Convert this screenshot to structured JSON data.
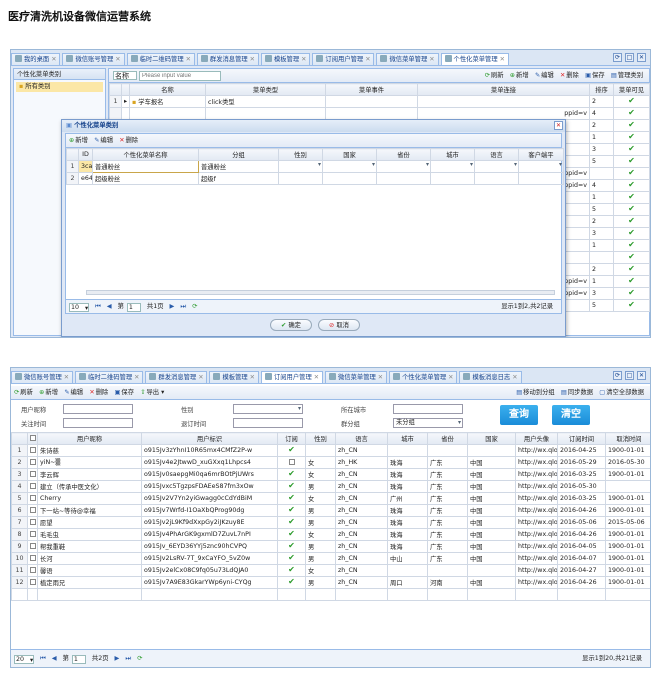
{
  "page_title": "医疗清洗机设备微信运营系统",
  "top": {
    "tabs": [
      "我的桌面",
      "微信账号管理",
      "临时二维码管理",
      "群发消息管理",
      "模板管理",
      "订阅用户管理",
      "微信菜单管理",
      "个性化菜单管理"
    ],
    "left_panel_title": "个性化菜单类别",
    "left_panel_item": "所有类别",
    "search_select": "名称",
    "search_placeholder": "Please input value",
    "toolbar": {
      "refresh": "刷新",
      "add": "新增",
      "edit": "编辑",
      "delete": "删除",
      "save": "保存",
      "manage": "管理类别"
    },
    "grid_headers": [
      "名称",
      "菜单类型",
      "菜单事件",
      "菜单连接",
      "排序",
      "菜单可见"
    ],
    "first_row": {
      "num": "1",
      "name": "学车报名",
      "type": "click类型"
    },
    "side_sort": [
      "2",
      "4",
      "2",
      "1",
      "3",
      "5",
      "",
      "4",
      "1",
      "5",
      "2",
      "3",
      "1",
      "",
      "2",
      "1",
      "3",
      "5"
    ],
    "ppid_label": "ppid=v",
    "dialog": {
      "title": "个性化菜单类别",
      "toolbar": {
        "add": "新增",
        "edit": "编辑",
        "delete": "删除"
      },
      "headers": [
        "ID",
        "个性化菜单名称",
        "分组",
        "性别",
        "国家",
        "省份",
        "城市",
        "语言",
        "客户端平"
      ],
      "rows": [
        {
          "num": "1",
          "id": "3ca",
          "name": "普通粉丝",
          "group": "普通粉丝"
        },
        {
          "num": "2",
          "id": "e64",
          "name": "超级粉丝",
          "group": "超级f"
        }
      ],
      "pager": {
        "size": "10",
        "page_label": "第",
        "page": "1",
        "total": "共1页",
        "info": "显示1到2,共2记录"
      },
      "ok": "确定",
      "cancel": "取消"
    }
  },
  "bottom": {
    "tabs": [
      "微信账号管理",
      "临时二维码管理",
      "群发消息管理",
      "模板管理",
      "订阅用户管理",
      "微信菜单管理",
      "个性化菜单管理",
      "模板消息日志"
    ],
    "toolbar": {
      "refresh": "刷新",
      "add": "新增",
      "edit": "编辑",
      "delete": "删除",
      "save": "保存",
      "export": "导出",
      "move_group": "移动到分组",
      "sync": "同步数据",
      "clear_all": "清空全部数据"
    },
    "filters": {
      "nickname": "用户昵称",
      "sex": "性别",
      "city": "所在城市",
      "follow_time": "关注时间",
      "unfollow_time": "退订时间",
      "group": "群分组",
      "group_value": "未分组",
      "query": "查询",
      "clear": "清空"
    },
    "headers": [
      "用户昵称",
      "用户标识",
      "订阅",
      "性别",
      "语言",
      "城市",
      "省份",
      "国家",
      "用户头像",
      "订阅时间",
      "取消时间"
    ],
    "rows": [
      {
        "n": "1",
        "nick": "朱诗慈",
        "openid": "o915Jv3zYhnI10R65mx4CMfZ2P-w",
        "sub": true,
        "sex": "",
        "lang": "zh_CN",
        "city": "",
        "prov": "",
        "country": "",
        "avatar": "http://wx.qlogo",
        "time": "2016-04-25",
        "cancel": "1900-01-01"
      },
      {
        "n": "2",
        "nick": "yiN~▒",
        "openid": "o915Jv4e2JtwwD_xuGXxq1Lhpcs4",
        "sub": false,
        "sex": "女",
        "lang": "zh_HK",
        "city": "珠海",
        "prov": "广东",
        "country": "中国",
        "avatar": "http://wx.qlogo",
        "time": "2016-05-29",
        "cancel": "2016-05-30"
      },
      {
        "n": "3",
        "nick": "李云辉",
        "openid": "o915Jv0saepgMi0qa6mrBOtPjUWrs",
        "sub": true,
        "sex": "女",
        "lang": "zh_CN",
        "city": "珠海",
        "prov": "广东",
        "country": "中国",
        "avatar": "http://wx.qlogo",
        "time": "2016-03-25",
        "cancel": "1900-01-01"
      },
      {
        "n": "4",
        "nick": "建立（传承中医文化）",
        "openid": "o915Jvxc5TgzpsFDAEeS87fm3xOw",
        "sub": true,
        "sex": "男",
        "lang": "zh_CN",
        "city": "珠海",
        "prov": "广东",
        "country": "中国",
        "avatar": "http://wx.qlogo",
        "time": "2016-05-30",
        "cancel": ""
      },
      {
        "n": "5",
        "nick": "Cherry",
        "openid": "o915Jv2V7Yn2yiGwagg0cCdYdBiM",
        "sub": true,
        "sex": "女",
        "lang": "zh_CN",
        "city": "广州",
        "prov": "广东",
        "country": "中国",
        "avatar": "http://wx.qlogo",
        "time": "2016-03-25",
        "cancel": "1900-01-01"
      },
      {
        "n": "6",
        "nick": "下一站~等待@幸福",
        "openid": "o915Jv7Wrfd-I1OaXbQProg90dg",
        "sub": true,
        "sex": "男",
        "lang": "zh_CN",
        "city": "珠海",
        "prov": "广东",
        "country": "中国",
        "avatar": "http://wx.qlogo",
        "time": "2016-04-26",
        "cancel": "1900-01-01"
      },
      {
        "n": "7",
        "nick": "愿望",
        "openid": "o915Jv2jL9Kf9dXxpGy2iJKzuy8E",
        "sub": true,
        "sex": "男",
        "lang": "zh_CN",
        "city": "珠海",
        "prov": "广东",
        "country": "中国",
        "avatar": "http://wx.qlogo",
        "time": "2016-05-06",
        "cancel": "2015-05-06"
      },
      {
        "n": "8",
        "nick": "毛毛虫",
        "openid": "o915Jv4PhArGK9gxmlD7ZuvL7nPI",
        "sub": true,
        "sex": "女",
        "lang": "zh_CN",
        "city": "珠海",
        "prov": "广东",
        "country": "中国",
        "avatar": "http://wx.qlogo",
        "time": "2016-04-26",
        "cancel": "1900-01-01"
      },
      {
        "n": "9",
        "nick": "帮我重鞋",
        "openid": "o915Jv_6EYD36YYj5znc90hCVPQ",
        "sub": true,
        "sex": "男",
        "lang": "zh_CN",
        "city": "珠海",
        "prov": "广东",
        "country": "中国",
        "avatar": "http://wx.qlogo",
        "time": "2016-04-05",
        "cancel": "1900-01-01"
      },
      {
        "n": "10",
        "nick": "长河",
        "openid": "o915Jv2LsRV-7T_9xCaYFO_5vZ0w",
        "sub": true,
        "sex": "男",
        "lang": "zh_CN",
        "city": "中山",
        "prov": "广东",
        "country": "中国",
        "avatar": "http://wx.qlogo",
        "time": "2016-04-07",
        "cancel": "1900-01-01"
      },
      {
        "n": "11",
        "nick": "馨语",
        "openid": "o915Jv2elCx08C9fq05u73LdQJA0",
        "sub": true,
        "sex": "女",
        "lang": "zh_CN",
        "city": "",
        "prov": "",
        "country": "",
        "avatar": "http://wx.qlogo",
        "time": "2016-04-27",
        "cancel": "1900-01-01"
      },
      {
        "n": "12",
        "nick": "植定雨兄",
        "openid": "o915Jv7A9E83GkarYWp6yni-CYQg",
        "sub": true,
        "sex": "男",
        "lang": "zh_CN",
        "city": "周口",
        "prov": "河南",
        "country": "中国",
        "avatar": "http://wx.qlogo",
        "time": "2016-04-26",
        "cancel": "1900-01-01"
      }
    ],
    "pager": {
      "size": "20",
      "page_label": "第",
      "page": "1",
      "total": "共2页",
      "info": "显示1到20,共21记录"
    }
  }
}
